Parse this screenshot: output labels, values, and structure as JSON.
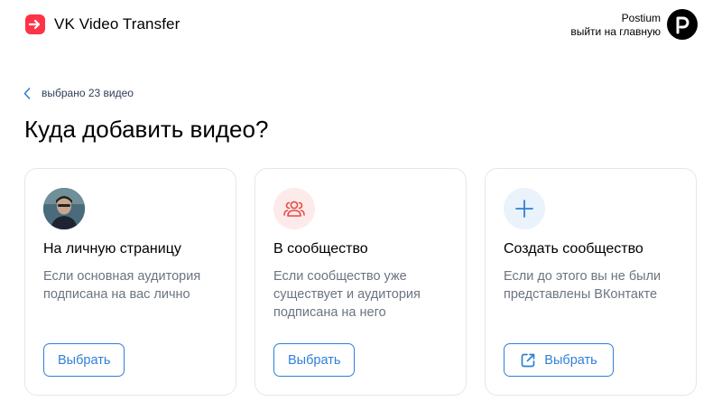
{
  "header": {
    "app_title": "VK Video Transfer",
    "user_name": "Postium",
    "exit_label": "выйти на главную",
    "brand_color": "#ff3347"
  },
  "back": {
    "label": "выбрано 23 видео"
  },
  "page_title": "Куда добавить видео?",
  "cards": [
    {
      "icon": "user-photo-icon",
      "title": "На личную страницу",
      "description": "Если основная аудитория подписана на вас лично",
      "button_label": "Выбрать"
    },
    {
      "icon": "community-icon",
      "title": "В сообщество",
      "description": "Если сообщество уже существует и аудитория подписана на него",
      "button_label": "Выбрать"
    },
    {
      "icon": "plus-icon",
      "title": "Создать сообщество",
      "description": "Если до этого вы не были представлены ВКонтакте",
      "button_label": "Выбрать",
      "button_icon": "external-link-icon"
    }
  ],
  "colors": {
    "accent": "#2f7fd8",
    "text_secondary": "#6b7480",
    "community_icon": "#e8493f",
    "community_bg": "#fdeaea",
    "plus_bg": "#eaf2fc"
  }
}
